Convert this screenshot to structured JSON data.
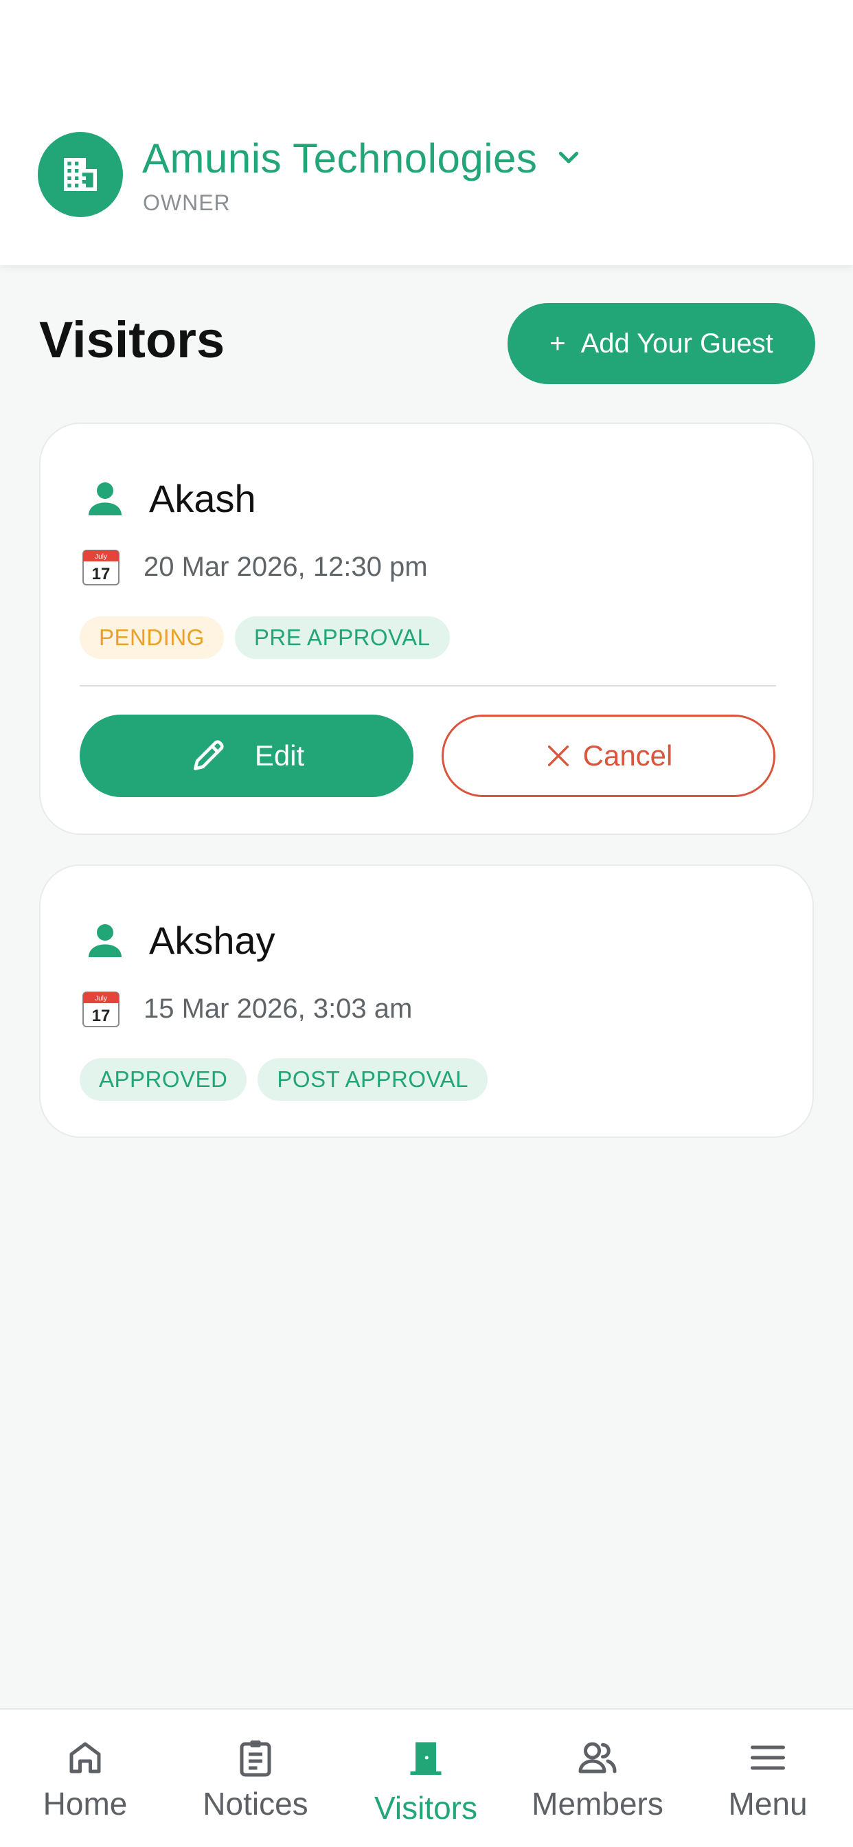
{
  "header": {
    "org_name": "Amunis Technologies",
    "org_role": "OWNER",
    "org_icon": "building-icon",
    "dropdown_icon": "chevron-down-icon"
  },
  "page": {
    "title": "Visitors",
    "add_guest_label": "Add Your Guest",
    "add_guest_icon_glyph": "+"
  },
  "visitors": [
    {
      "name": "Akash",
      "datetime": "20 Mar 2026, 12:30 pm",
      "status": "PENDING",
      "approval_type": "PRE APPROVAL",
      "actions": {
        "edit_label": "Edit",
        "cancel_label": "Cancel"
      },
      "calendar_icon": {
        "month": "July",
        "day": "17"
      }
    },
    {
      "name": "Akshay",
      "datetime": "15 Mar 2026, 3:03 am",
      "status": "APPROVED",
      "approval_type": "POST APPROVAL",
      "calendar_icon": {
        "month": "July",
        "day": "17"
      }
    }
  ],
  "bottom_nav": {
    "items": [
      {
        "label": "Home",
        "icon": "home-icon",
        "active": false
      },
      {
        "label": "Notices",
        "icon": "clipboard-icon",
        "active": false
      },
      {
        "label": "Visitors",
        "icon": "door-icon",
        "active": true
      },
      {
        "label": "Members",
        "icon": "members-icon",
        "active": false
      },
      {
        "label": "Menu",
        "icon": "hamburger-icon",
        "active": false
      }
    ]
  },
  "colors": {
    "primary": "#22a678",
    "danger": "#d9553b",
    "pending_text": "#e8a22a",
    "pending_bg": "#fff3e2",
    "badge_green_bg": "#e3f4ed",
    "background": "#f6f8f7"
  }
}
